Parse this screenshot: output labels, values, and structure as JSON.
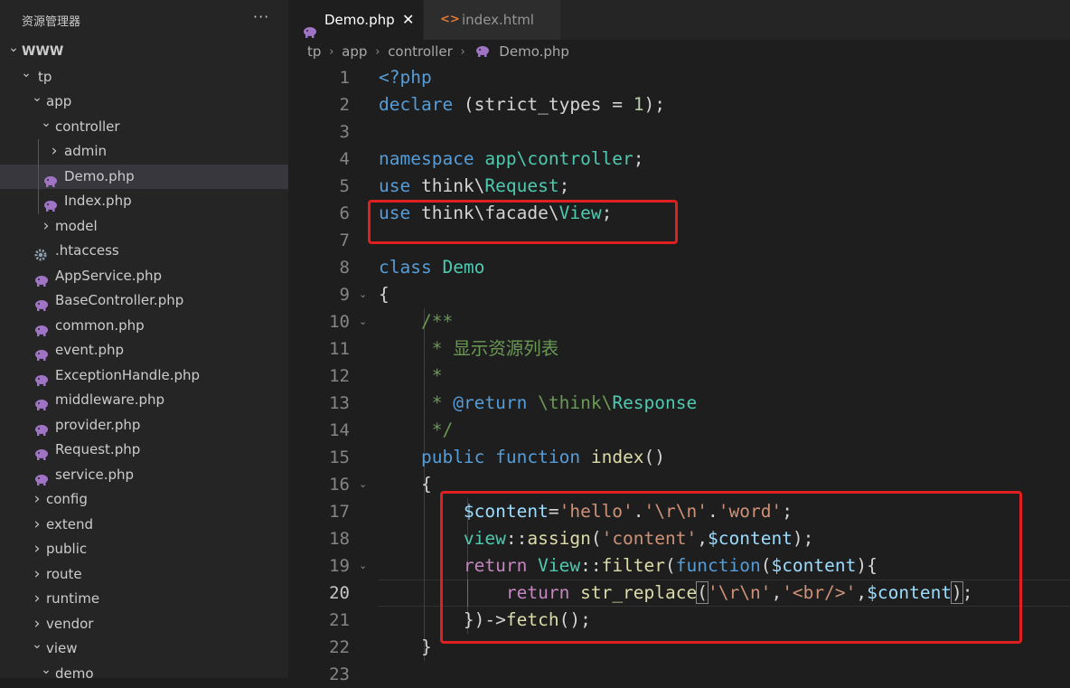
{
  "sidebar": {
    "title": "资源管理器",
    "more": "···",
    "tree": [
      {
        "label": "WWW",
        "kind": "folder",
        "open": true,
        "depth": 0,
        "root": true
      },
      {
        "label": "tp",
        "kind": "folder",
        "open": true,
        "depth": 1
      },
      {
        "label": "app",
        "kind": "folder",
        "open": true,
        "depth": 2
      },
      {
        "label": "controller",
        "kind": "folder",
        "open": true,
        "depth": 3
      },
      {
        "label": "admin",
        "kind": "folder",
        "open": false,
        "depth": 4
      },
      {
        "label": "Demo.php",
        "kind": "php",
        "depth": 4,
        "selected": true
      },
      {
        "label": "Index.php",
        "kind": "php",
        "depth": 4
      },
      {
        "label": "model",
        "kind": "folder",
        "open": false,
        "depth": 3
      },
      {
        "label": ".htaccess",
        "kind": "gear",
        "depth": 3
      },
      {
        "label": "AppService.php",
        "kind": "php",
        "depth": 3
      },
      {
        "label": "BaseController.php",
        "kind": "php",
        "depth": 3
      },
      {
        "label": "common.php",
        "kind": "php",
        "depth": 3
      },
      {
        "label": "event.php",
        "kind": "php",
        "depth": 3
      },
      {
        "label": "ExceptionHandle.php",
        "kind": "php",
        "depth": 3
      },
      {
        "label": "middleware.php",
        "kind": "php",
        "depth": 3
      },
      {
        "label": "provider.php",
        "kind": "php",
        "depth": 3
      },
      {
        "label": "Request.php",
        "kind": "php",
        "depth": 3
      },
      {
        "label": "service.php",
        "kind": "php",
        "depth": 3
      },
      {
        "label": "config",
        "kind": "folder",
        "open": false,
        "depth": 2
      },
      {
        "label": "extend",
        "kind": "folder",
        "open": false,
        "depth": 2
      },
      {
        "label": "public",
        "kind": "folder",
        "open": false,
        "depth": 2
      },
      {
        "label": "route",
        "kind": "folder",
        "open": false,
        "depth": 2
      },
      {
        "label": "runtime",
        "kind": "folder",
        "open": false,
        "depth": 2
      },
      {
        "label": "vendor",
        "kind": "folder",
        "open": false,
        "depth": 2
      },
      {
        "label": "view",
        "kind": "folder",
        "open": true,
        "depth": 2
      },
      {
        "label": "demo",
        "kind": "folder",
        "open": true,
        "depth": 3
      }
    ]
  },
  "tabs": {
    "active_label": "Demo.php",
    "close_glyph": "✕",
    "other_label": "index.html",
    "other_icon": "<>"
  },
  "breadcrumb": {
    "parts": [
      "tp",
      "app",
      "controller",
      "Demo.php"
    ],
    "sep": "›"
  },
  "editor": {
    "active_line": 20,
    "lines": [
      {
        "n": "1",
        "fold": "",
        "t": [
          [
            "kw",
            "<?php"
          ]
        ]
      },
      {
        "n": "2",
        "fold": "",
        "t": [
          [
            "kw",
            "declare"
          ],
          [
            "plain",
            " (strict_types = "
          ],
          [
            "num",
            "1"
          ],
          [
            "plain",
            ");"
          ]
        ]
      },
      {
        "n": "3",
        "fold": "",
        "t": []
      },
      {
        "n": "4",
        "fold": "",
        "t": [
          [
            "kw",
            "namespace"
          ],
          [
            "plain",
            " "
          ],
          [
            "cls",
            "app\\controller"
          ],
          [
            "plain",
            ";"
          ]
        ]
      },
      {
        "n": "5",
        "fold": "",
        "t": [
          [
            "kw",
            "use"
          ],
          [
            "plain",
            " think\\"
          ],
          [
            "cls",
            "Request"
          ],
          [
            "plain",
            ";"
          ]
        ]
      },
      {
        "n": "6",
        "fold": "",
        "t": [
          [
            "kw",
            "use"
          ],
          [
            "plain",
            " think\\facade\\"
          ],
          [
            "cls",
            "View"
          ],
          [
            "plain",
            ";"
          ]
        ]
      },
      {
        "n": "7",
        "fold": "",
        "t": []
      },
      {
        "n": "8",
        "fold": "",
        "t": [
          [
            "kw",
            "class"
          ],
          [
            "plain",
            " "
          ],
          [
            "cls",
            "Demo"
          ]
        ]
      },
      {
        "n": "9",
        "fold": "⌄",
        "t": [
          [
            "plain",
            "{"
          ]
        ]
      },
      {
        "n": "10",
        "fold": "⌄",
        "t": [
          [
            "plain",
            "    "
          ],
          [
            "com",
            "/**"
          ]
        ]
      },
      {
        "n": "11",
        "fold": "",
        "t": [
          [
            "plain",
            "    "
          ],
          [
            "com",
            " * 显示资源列表"
          ]
        ]
      },
      {
        "n": "12",
        "fold": "",
        "t": [
          [
            "plain",
            "    "
          ],
          [
            "com",
            " *"
          ]
        ]
      },
      {
        "n": "13",
        "fold": "",
        "t": [
          [
            "plain",
            "    "
          ],
          [
            "com",
            " * "
          ],
          [
            "kw",
            "@return"
          ],
          [
            "plain",
            " "
          ],
          [
            "com",
            "\\think\\"
          ],
          [
            "cls",
            "Response"
          ]
        ]
      },
      {
        "n": "14",
        "fold": "",
        "t": [
          [
            "plain",
            "    "
          ],
          [
            "com",
            " */"
          ]
        ]
      },
      {
        "n": "15",
        "fold": "",
        "t": [
          [
            "plain",
            "    "
          ],
          [
            "kw",
            "public"
          ],
          [
            "plain",
            " "
          ],
          [
            "kw",
            "function"
          ],
          [
            "plain",
            " "
          ],
          [
            "fn",
            "index"
          ],
          [
            "plain",
            "()"
          ]
        ]
      },
      {
        "n": "16",
        "fold": "⌄",
        "t": [
          [
            "plain",
            "    {"
          ]
        ]
      },
      {
        "n": "17",
        "fold": "",
        "t": [
          [
            "plain",
            "        "
          ],
          [
            "var",
            "$content"
          ],
          [
            "plain",
            "="
          ],
          [
            "str",
            "'hello'"
          ],
          [
            "plain",
            "."
          ],
          [
            "str",
            "'\\r\\n'"
          ],
          [
            "plain",
            "."
          ],
          [
            "str",
            "'word'"
          ],
          [
            "plain",
            ";"
          ]
        ]
      },
      {
        "n": "18",
        "fold": "",
        "t": [
          [
            "plain",
            "        "
          ],
          [
            "cls",
            "view"
          ],
          [
            "plain",
            "::"
          ],
          [
            "fn",
            "assign"
          ],
          [
            "plain",
            "("
          ],
          [
            "str",
            "'content'"
          ],
          [
            "plain",
            ","
          ],
          [
            "var",
            "$content"
          ],
          [
            "plain",
            ");"
          ]
        ]
      },
      {
        "n": "19",
        "fold": "⌄",
        "t": [
          [
            "plain",
            "        "
          ],
          [
            "ctl",
            "return"
          ],
          [
            "plain",
            " "
          ],
          [
            "cls",
            "View"
          ],
          [
            "plain",
            "::"
          ],
          [
            "fn",
            "filter"
          ],
          [
            "plain",
            "("
          ],
          [
            "kw",
            "function"
          ],
          [
            "plain",
            "("
          ],
          [
            "var",
            "$content"
          ],
          [
            "plain",
            "){"
          ]
        ]
      },
      {
        "n": "20",
        "fold": "",
        "t": [
          [
            "plain",
            "            "
          ],
          [
            "ctl",
            "return"
          ],
          [
            "plain",
            " "
          ],
          [
            "fn",
            "str_replace"
          ],
          [
            "bm",
            "("
          ],
          [
            "str",
            "'\\r\\n'"
          ],
          [
            "plain",
            ","
          ],
          [
            "str",
            "'<br/>'"
          ],
          [
            "plain",
            ","
          ],
          [
            "var",
            "$content"
          ],
          [
            "bm",
            ")"
          ],
          [
            "plain",
            ";"
          ]
        ]
      },
      {
        "n": "21",
        "fold": "",
        "t": [
          [
            "plain",
            "        })->"
          ],
          [
            "fn",
            "fetch"
          ],
          [
            "plain",
            "();"
          ]
        ]
      },
      {
        "n": "22",
        "fold": "",
        "t": [
          [
            "plain",
            "    }"
          ]
        ]
      },
      {
        "n": "23",
        "fold": "",
        "t": []
      }
    ]
  },
  "colors": {
    "highlight_box": "#e02020",
    "php_icon": "#a074c4",
    "html_icon": "#e37933"
  }
}
